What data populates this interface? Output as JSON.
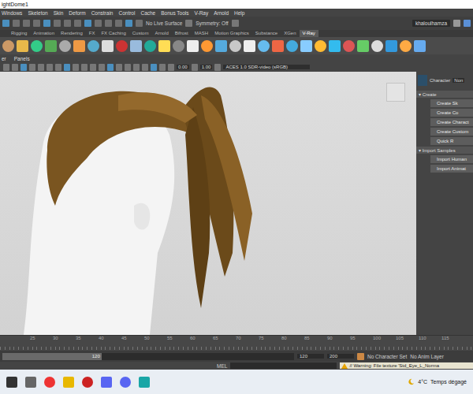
{
  "window": {
    "title": "ightDome1"
  },
  "menu_bar": [
    "Windows",
    "Skeleton",
    "Skin",
    "Deform",
    "Constrain",
    "Control",
    "Cache",
    "Bonus Tools",
    "V-Ray",
    "Arnold",
    "Help"
  ],
  "status_line": {
    "live_surface": "No Live Surface",
    "symmetry": "Symmetry: Off",
    "user": "khaloulhamza"
  },
  "shelf_tabs": [
    {
      "label": "Rigging",
      "selected": false
    },
    {
      "label": "Animation",
      "selected": false
    },
    {
      "label": "Rendering",
      "selected": false
    },
    {
      "label": "FX",
      "selected": false
    },
    {
      "label": "FX Caching",
      "selected": false
    },
    {
      "label": "Custom",
      "selected": false
    },
    {
      "label": "Arnold",
      "selected": false
    },
    {
      "label": "Bifrost",
      "selected": false
    },
    {
      "label": "MASH",
      "selected": false
    },
    {
      "label": "Motion Graphics",
      "selected": false
    },
    {
      "label": "Substance",
      "selected": false
    },
    {
      "label": "XGen",
      "selected": false
    },
    {
      "label": "V-Ray",
      "selected": true
    }
  ],
  "panel_menu": [
    "er",
    "Panels"
  ],
  "viewport_toolbar": {
    "exposure": "0.00",
    "gamma": "1.00",
    "color_space": "ACES 1.0 SDR-video (sRGB)"
  },
  "character_panel": {
    "title": "Character",
    "dropdown": "Non",
    "sections": [
      {
        "title": "Create",
        "expanded": true,
        "buttons": [
          "Create Sk",
          "Create Co",
          "Create Charact",
          "Create Custom",
          "Quick R"
        ]
      },
      {
        "title": "Import Samples",
        "expanded": true,
        "buttons": [
          "Import Human",
          "Import Animat"
        ]
      }
    ]
  },
  "time_slider": {
    "ticks": [
      "25",
      "30",
      "35",
      "40",
      "45",
      "50",
      "55",
      "60",
      "65",
      "70",
      "75",
      "80",
      "85",
      "90",
      "95",
      "100",
      "105",
      "110",
      "115"
    ]
  },
  "range_slider": {
    "bar_end": "120",
    "level": 0.34,
    "end": "120",
    "max": "200",
    "character_set": "No Character Set",
    "anim_layer": "No Anim Layer"
  },
  "command_line": {
    "language": "MEL",
    "warning": "// Warning: File texture 'Std_Eye_L_Norma"
  },
  "taskbar": {
    "temperature": "4°C",
    "weather": "Temps dégagé"
  }
}
